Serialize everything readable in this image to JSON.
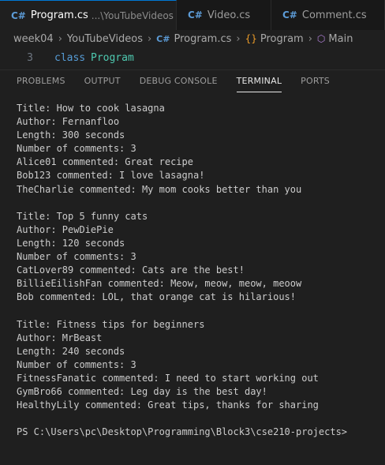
{
  "tabs": [
    {
      "icon": "C#",
      "label": "Program.cs",
      "sublabel": "...\\YouTubeVideos",
      "close": "×",
      "active": true
    },
    {
      "icon": "C#",
      "label": "Video.cs",
      "active": false
    },
    {
      "icon": "C#",
      "label": "Comment.cs",
      "active": false
    }
  ],
  "breadcrumb": {
    "items": [
      "week04",
      "YouTubeVideos",
      "Program.cs",
      "Program",
      "Main"
    ]
  },
  "editor": {
    "line_number": "3",
    "keyword": "class",
    "class_name": "Program"
  },
  "panel": {
    "tabs": [
      "PROBLEMS",
      "OUTPUT",
      "DEBUG CONSOLE",
      "TERMINAL",
      "PORTS"
    ],
    "active_tab": "TERMINAL"
  },
  "terminal": {
    "lines": [
      "Title: How to cook lasagna",
      "Author: Fernanfloo",
      "Length: 300 seconds",
      "Number of comments: 3",
      "Alice01 commented: Great recipe",
      "Bob123 commented: I love lasagna!",
      "TheCharlie commented: My mom cooks better than you",
      "",
      "Title: Top 5 funny cats",
      "Author: PewDiePie",
      "Length: 120 seconds",
      "Number of comments: 3",
      "CatLover89 commented: Cats are the best!",
      "BillieEilishFan commented: Meow, meow, meow, meoow",
      "Bob commented: LOL, that orange cat is hilarious!",
      "",
      "Title: Fitness tips for beginners",
      "Author: MrBeast",
      "Length: 240 seconds",
      "Number of comments: 3",
      "FitnessFanatic commented: I need to start working out",
      "GymBro66 commented: Leg day is the best day!",
      "HealthyLily commented: Great tips, thanks for sharing",
      "",
      "PS C:\\Users\\pc\\Desktop\\Programming\\Block3\\cse210-projects>"
    ]
  },
  "colors": {
    "background": "#1f1f1f",
    "accent": "#0078d4",
    "keyword": "#569cd6",
    "class_name": "#4ec9b0"
  }
}
